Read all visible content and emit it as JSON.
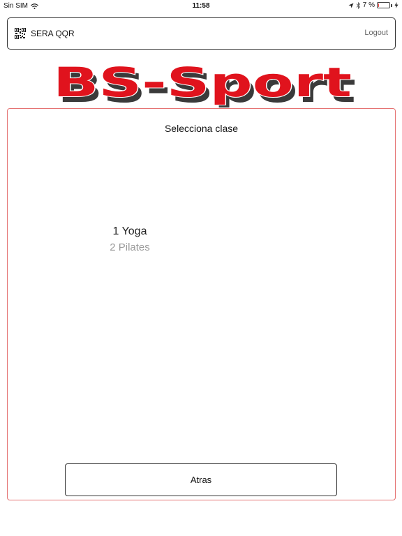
{
  "status_bar": {
    "carrier": "Sin SIM",
    "time": "11:58",
    "battery_percent_label": "7 %",
    "battery_level": 0.07,
    "icons": [
      "wifi-icon",
      "location-arrow-icon",
      "bluetooth-icon",
      "battery-icon",
      "charging-bolt-icon"
    ]
  },
  "header": {
    "title": "SERA QQR",
    "logout_label": "Logout",
    "icon": "qr-code-icon"
  },
  "logo": {
    "text": "BS-Sport",
    "color": "#e0131d"
  },
  "panel": {
    "title": "Selecciona clase",
    "border_color": "#e57373",
    "classes": [
      "1 Yoga",
      "2 Pilates"
    ],
    "selected_index": 0
  },
  "footer": {
    "back_label": "Atras"
  }
}
